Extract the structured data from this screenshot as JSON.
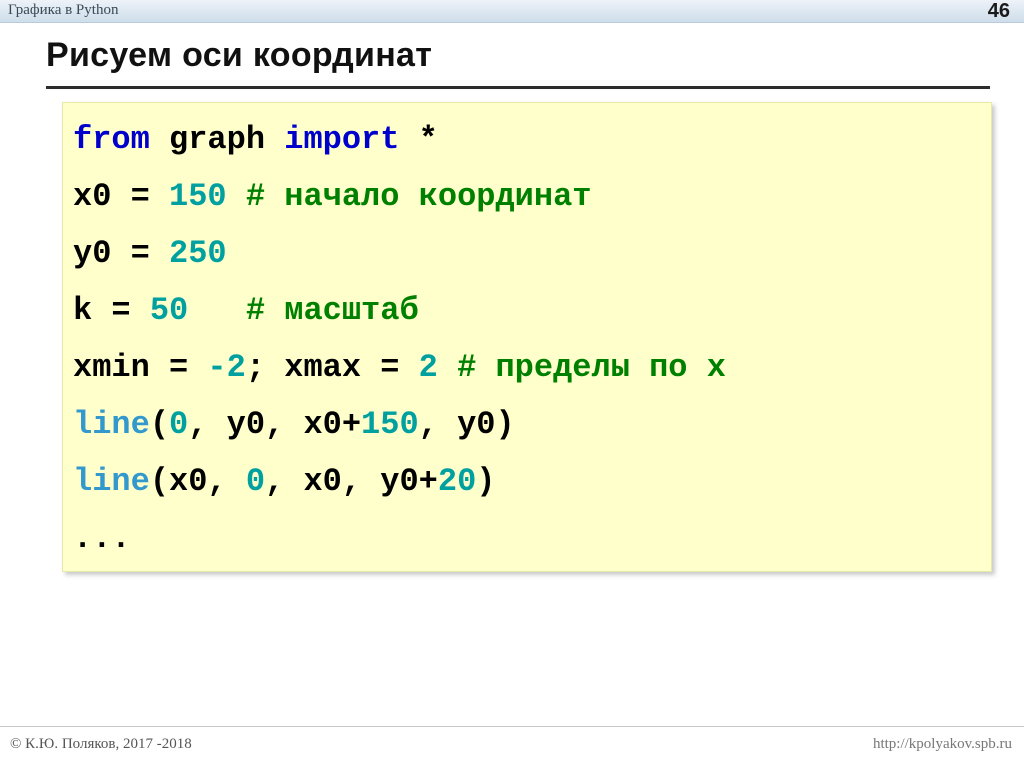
{
  "header": {
    "title": "Графика в Python",
    "slide_number": "46"
  },
  "title": "Рисуем оси координат",
  "code": {
    "lines": [
      [
        {
          "t": "from",
          "c": "kw"
        },
        {
          "t": " graph ",
          "c": "pl"
        },
        {
          "t": "import",
          "c": "kw"
        },
        {
          "t": " *",
          "c": "pl"
        }
      ],
      [
        {
          "t": "x0 = ",
          "c": "pl"
        },
        {
          "t": "150",
          "c": "num"
        },
        {
          "t": " ",
          "c": "pl"
        },
        {
          "t": "# начало координат",
          "c": "cm"
        }
      ],
      [
        {
          "t": "y0 = ",
          "c": "pl"
        },
        {
          "t": "250",
          "c": "num"
        }
      ],
      [
        {
          "t": "k = ",
          "c": "pl"
        },
        {
          "t": "50",
          "c": "num"
        },
        {
          "t": "   ",
          "c": "pl"
        },
        {
          "t": "# масштаб",
          "c": "cm"
        }
      ],
      [
        {
          "t": "xmin = ",
          "c": "pl"
        },
        {
          "t": "-2",
          "c": "num"
        },
        {
          "t": "; xmax = ",
          "c": "pl"
        },
        {
          "t": "2",
          "c": "num"
        },
        {
          "t": " ",
          "c": "pl"
        },
        {
          "t": "# пределы по x",
          "c": "cm"
        }
      ],
      [
        {
          "t": "line",
          "c": "fn"
        },
        {
          "t": "(",
          "c": "pl"
        },
        {
          "t": "0",
          "c": "num"
        },
        {
          "t": ", y0, x0+",
          "c": "pl"
        },
        {
          "t": "150",
          "c": "num"
        },
        {
          "t": ", y0)",
          "c": "pl"
        }
      ],
      [
        {
          "t": "line",
          "c": "fn"
        },
        {
          "t": "(x0, ",
          "c": "pl"
        },
        {
          "t": "0",
          "c": "num"
        },
        {
          "t": ", x0, y0+",
          "c": "pl"
        },
        {
          "t": "20",
          "c": "num"
        },
        {
          "t": ")",
          "c": "pl"
        }
      ],
      [
        {
          "t": "...",
          "c": "pl"
        }
      ]
    ]
  },
  "footer": {
    "copyright": "© К.Ю. Поляков, 2017 -2018",
    "url": "http://kpolyakov.spb.ru"
  },
  "colors": {
    "code_background": "#ffffcc",
    "keyword": "#0000cc",
    "number": "#00a0a0",
    "comment": "#008000",
    "function": "#3399cc",
    "header_bar": "#dbe6f0"
  }
}
